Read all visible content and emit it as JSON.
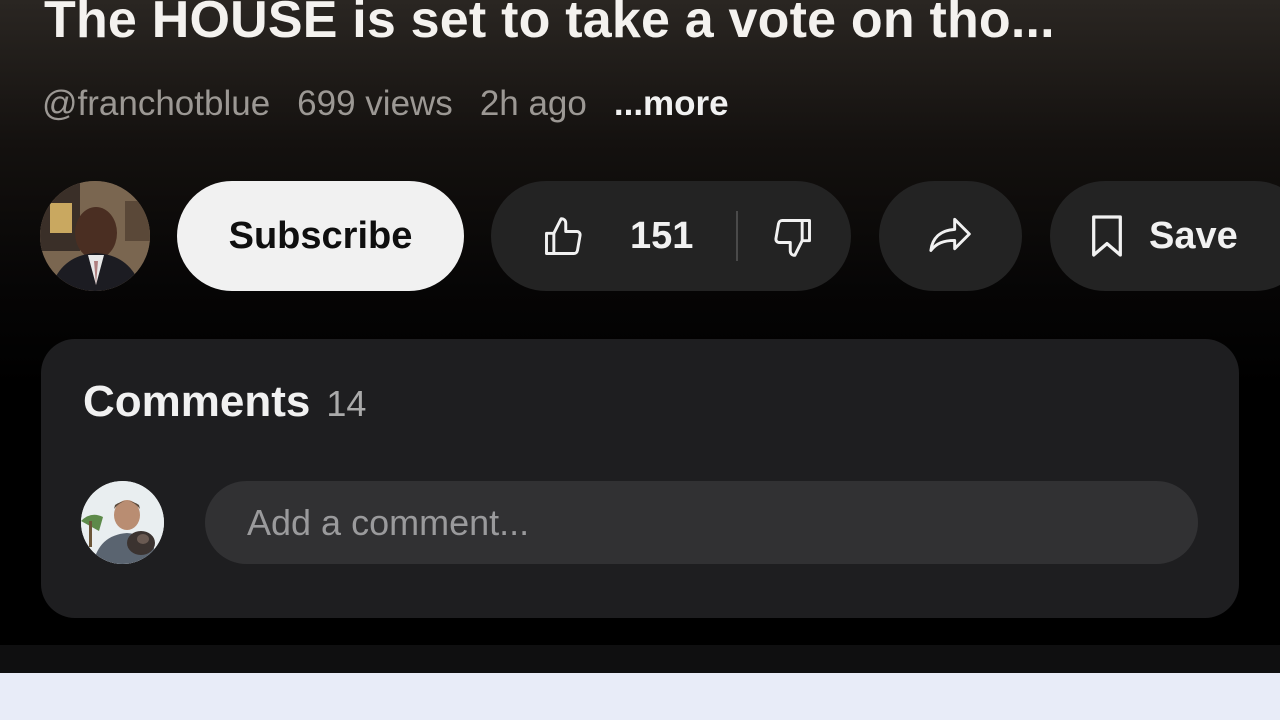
{
  "video": {
    "title": "The HOUSE is set to take a vote on tho...",
    "channel_handle": "@franchotblue",
    "views": "699 views",
    "age": "2h ago",
    "more_label": "...more"
  },
  "actions": {
    "subscribe_label": "Subscribe",
    "like_count": "151",
    "save_label": "Save"
  },
  "comments": {
    "title": "Comments",
    "count": "14",
    "input_placeholder": "Add a comment..."
  },
  "icons": {
    "like": "thumbs-up-icon",
    "dislike": "thumbs-down-icon",
    "share": "share-arrow-icon",
    "save": "bookmark-icon"
  },
  "colors": {
    "subscribe_bg": "#f1f1f1",
    "pill_bg": "#232323",
    "card_bg": "#1e1e20",
    "input_bg": "#313133",
    "bottom_bar": "#e8ecf8"
  }
}
